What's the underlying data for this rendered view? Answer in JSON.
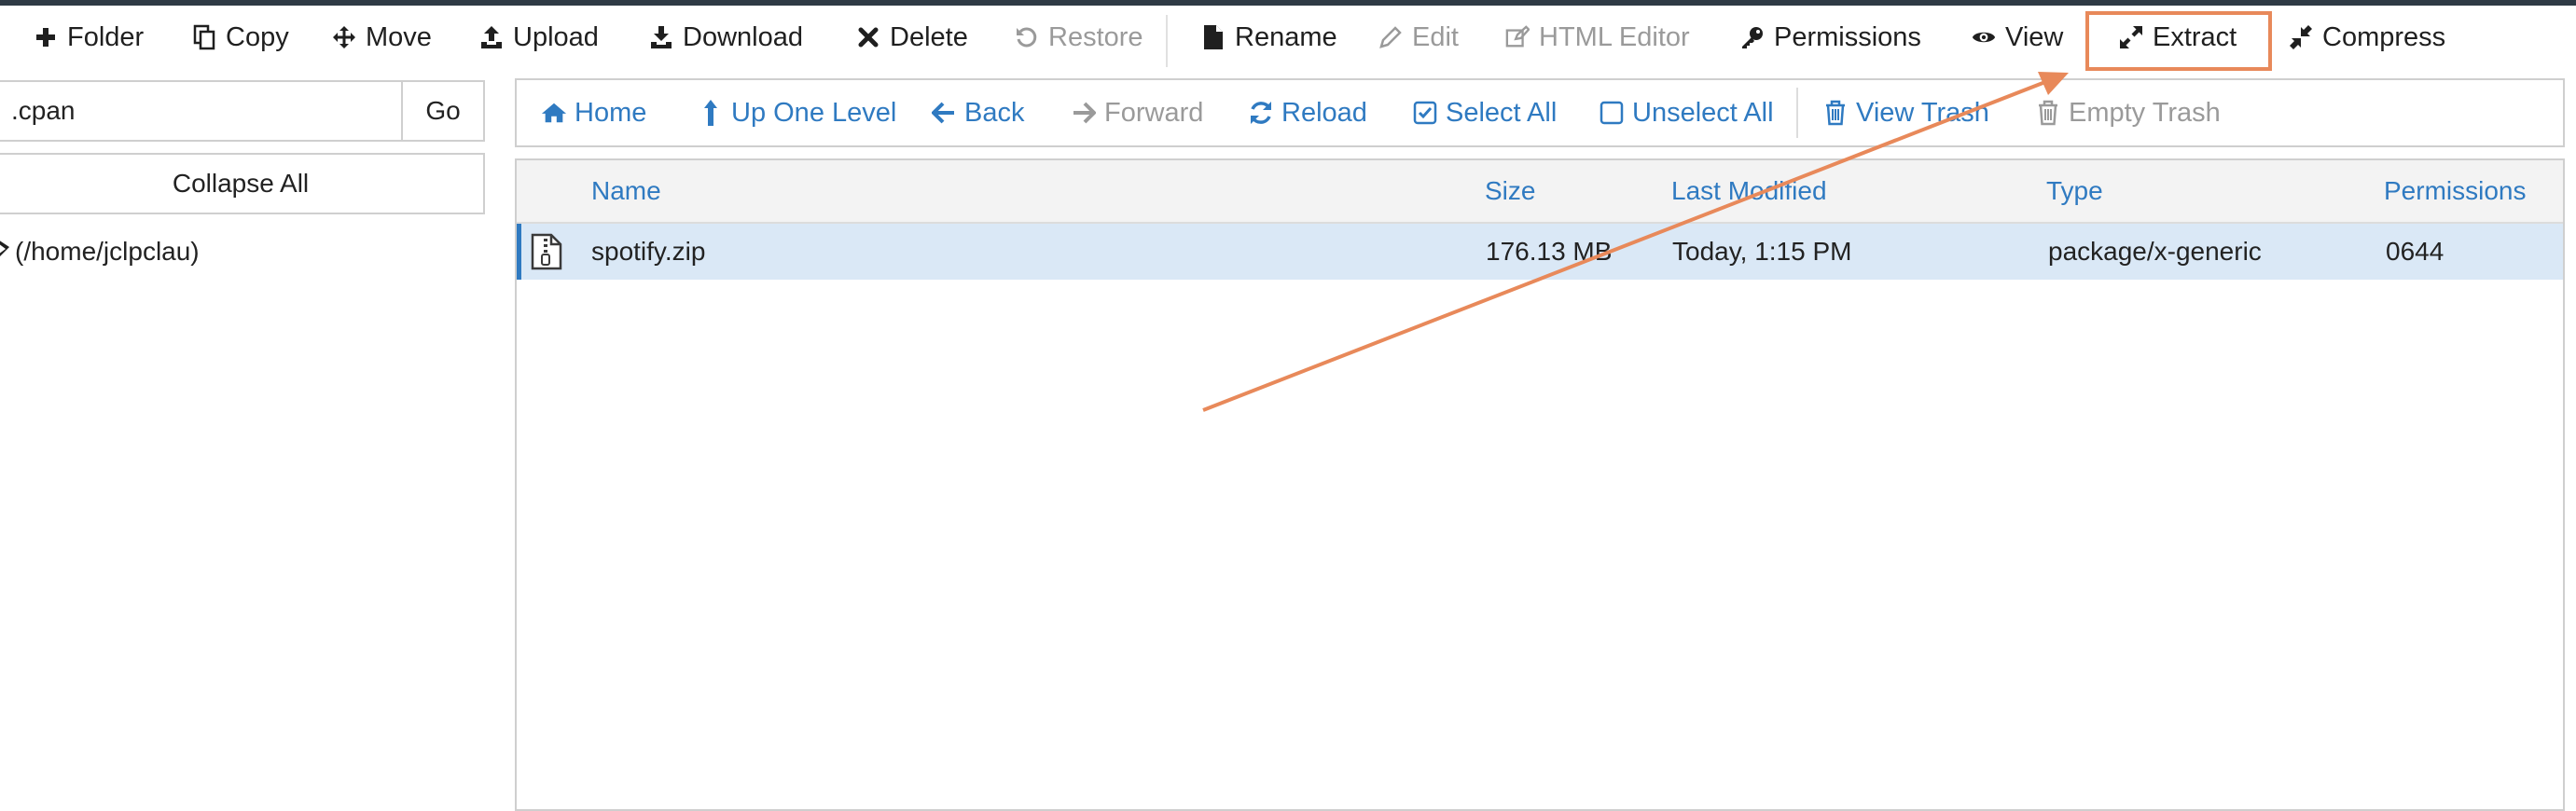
{
  "toolbar": {
    "folder": "Folder",
    "copy": "Copy",
    "move": "Move",
    "upload": "Upload",
    "download": "Download",
    "delete": "Delete",
    "restore": "Restore",
    "rename": "Rename",
    "edit": "Edit",
    "html_editor": "HTML Editor",
    "permissions": "Permissions",
    "view": "View",
    "extract": "Extract",
    "compress": "Compress"
  },
  "sidebar": {
    "path_value": ".cpan",
    "go_label": "Go",
    "collapse_label": "Collapse All",
    "tree_root": "(/home/jclpclau)"
  },
  "nav": {
    "home": "Home",
    "up_one_level": "Up One Level",
    "back": "Back",
    "forward": "Forward",
    "reload": "Reload",
    "select_all": "Select All",
    "unselect_all": "Unselect All",
    "view_trash": "View Trash",
    "empty_trash": "Empty Trash"
  },
  "table": {
    "columns": {
      "name": "Name",
      "size": "Size",
      "last_modified": "Last Modified",
      "type": "Type",
      "permissions": "Permissions"
    },
    "rows": [
      {
        "name": "spotify.zip",
        "size": "176.13 MB",
        "last_modified": "Today, 1:15 PM",
        "type": "package/x-generic",
        "permissions": "0644"
      }
    ]
  },
  "colors": {
    "link": "#2f7ac1",
    "annotation": "#e8895a",
    "selected_row": "#dae8f6"
  }
}
